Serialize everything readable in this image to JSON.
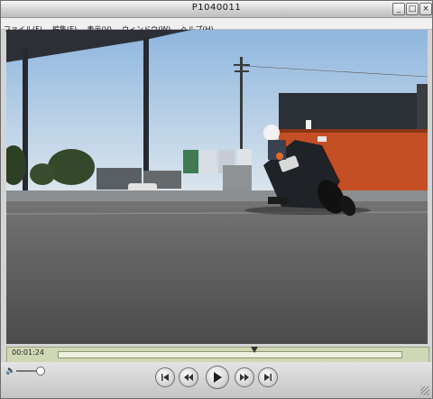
{
  "window": {
    "title": "P1040011"
  },
  "menu": [
    "ファイル(F)",
    "編集(E)",
    "表示(V)",
    "ウィンドウ(W)",
    "ヘルプ(H)"
  ],
  "player": {
    "timecode": "00:01:24",
    "position_fraction": 0.57
  },
  "volume": {
    "level_fraction": 0.85
  },
  "icons": {
    "minimize": "minimize-icon",
    "maximize": "maximize-icon",
    "close": "close-icon",
    "speaker": "speaker-icon",
    "prev": "skip-back-icon",
    "rewind": "rewind-icon",
    "play": "play-icon",
    "forward": "fast-forward-icon",
    "next": "skip-forward-icon"
  },
  "colors": {
    "accent_strip": "#cfd8b4",
    "sky": "#bcd3ea",
    "building": "#c44f25"
  }
}
